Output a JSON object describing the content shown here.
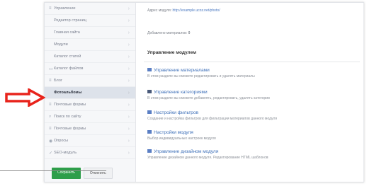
{
  "sidebar": {
    "items": [
      {
        "icon": "list-icon",
        "glyph": "≡",
        "label": "Управление"
      },
      {
        "icon": "none",
        "glyph": "",
        "label": "Редактор страниц"
      },
      {
        "icon": "none",
        "glyph": "",
        "label": "Главная сайта"
      },
      {
        "icon": "none",
        "glyph": "",
        "label": "Модули"
      },
      {
        "icon": "none",
        "glyph": "",
        "label": "Каталог статей"
      },
      {
        "icon": "folder-icon",
        "glyph": "▭",
        "label": "Каталог файлов"
      },
      {
        "icon": "list-icon",
        "glyph": "≡",
        "label": "Блог"
      },
      {
        "icon": "none",
        "glyph": "",
        "label": "Фотоальбомы"
      },
      {
        "icon": "list-icon",
        "glyph": "≡",
        "label": "Почтовые формы"
      },
      {
        "icon": "search-icon",
        "glyph": "⌕",
        "label": "Поиск по сайту"
      },
      {
        "icon": "list-icon",
        "glyph": "≡",
        "label": "Почтовые формы"
      },
      {
        "icon": "user-icon",
        "glyph": "◉",
        "label": "Опросы"
      },
      {
        "icon": "tool-icon",
        "glyph": "✓",
        "label": "SEO-модуль"
      }
    ],
    "active_index": 7,
    "save_label": "Сохранить",
    "cancel_label": "Отменить"
  },
  "main": {
    "module_address_label": "Адрес модуля:",
    "module_address_value": "http://example.ucoz.net/photo/",
    "materials_added_label": "Добавлено материалов:",
    "materials_added_value": "0",
    "section_title": "Управление модулем",
    "entries": [
      {
        "icon": "list-icon",
        "title": "Управление материалами",
        "desc": "В этом разделе вы сможете редактировать и удалять материалы"
      },
      {
        "icon": "folder-icon",
        "title": "Управление категориями",
        "desc": "В этом разделе вы сможете добавлять, редактировать, удалять категории"
      },
      {
        "icon": "filter-icon",
        "title": "Настройки фильтров",
        "desc": "Создание и настройка фильтров для фильтрации материалов данного модуля"
      },
      {
        "icon": "gear-icon",
        "title": "Настройки модуля",
        "desc": "Выбор индивидуальных настроек модуля"
      },
      {
        "icon": "design-icon",
        "title": "Управление дизайном модуля",
        "desc": "Управление дизайном данного модуля. Редактирование HTML шаблонов"
      }
    ]
  },
  "colors": {
    "accent": "#3d6fb8",
    "arrow": "#e8231b",
    "save_button": "#2e9e4a"
  }
}
